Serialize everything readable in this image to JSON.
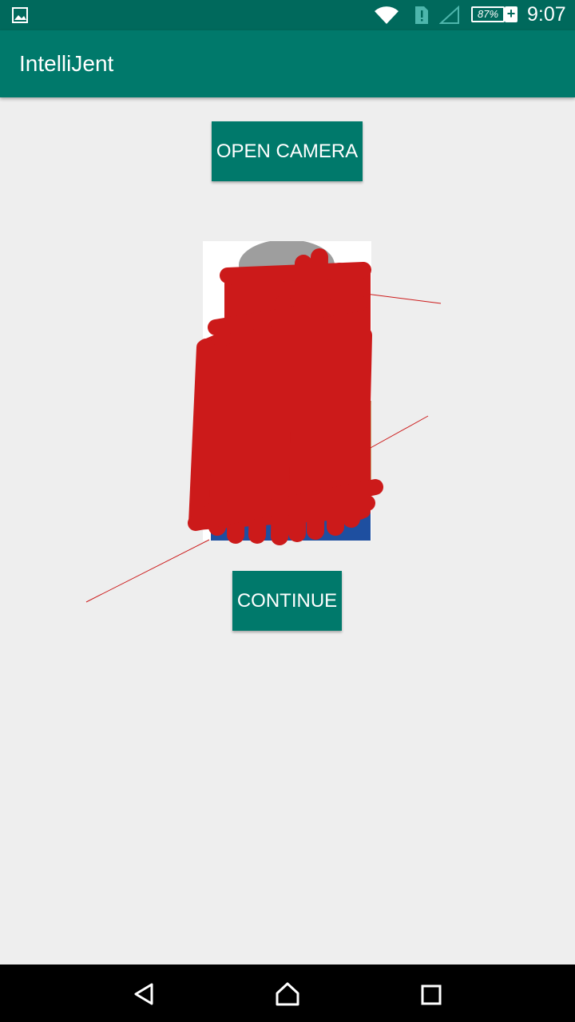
{
  "status_bar": {
    "battery_percent": "87%",
    "time": "9:07",
    "icons": [
      "gallery-icon",
      "wifi-icon",
      "sim-alert-icon",
      "signal-icon",
      "battery-charging-icon"
    ]
  },
  "app_bar": {
    "title": "IntelliJent"
  },
  "main": {
    "open_camera_label": "OPEN CAMERA",
    "continue_label": "CONTINUE",
    "photo": {
      "description_icon": "redacted-photo"
    }
  },
  "nav_bar": {
    "icons": [
      "back-icon",
      "home-icon",
      "recents-icon"
    ]
  },
  "colors": {
    "primary_dark": "#00695c",
    "primary": "#00796b",
    "background": "#eeeeee",
    "scribble": "#cc1a1a"
  }
}
